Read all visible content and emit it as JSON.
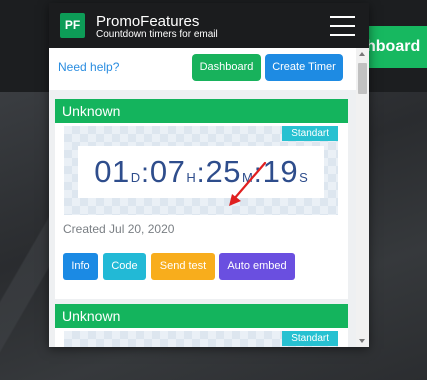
{
  "background": {
    "dashboard_button_label": "hboard"
  },
  "header": {
    "logo_text": "PF",
    "brand_name": "PromoFeatures",
    "tagline": "Countdown timers for email"
  },
  "toolbar": {
    "help_label": "Need help?",
    "dashboard_label": "Dashboard",
    "create_timer_label": "Create Timer"
  },
  "timers": [
    {
      "title": "Unknown",
      "badge": "Standart",
      "countdown": {
        "days": "01",
        "days_unit": "D",
        "hours": "07",
        "hours_unit": "H",
        "minutes": "25",
        "minutes_unit": "M",
        "seconds": "19",
        "seconds_unit": "S"
      },
      "created": "Created Jul 20, 2020",
      "actions": {
        "info": "Info",
        "code": "Code",
        "send_test": "Send test",
        "auto_embed": "Auto embed"
      }
    },
    {
      "title": "Unknown",
      "badge": "Standart"
    }
  ],
  "colors": {
    "brand_green": "#14b45d",
    "header_dark": "#1b1c1e",
    "info_blue": "#1b8ae4",
    "code_cyan": "#22b9d6",
    "send_orange": "#f8ad1c",
    "embed_purple": "#6a4fe0",
    "arrow_red": "#e02020",
    "timer_text": "#2e4d8c"
  }
}
